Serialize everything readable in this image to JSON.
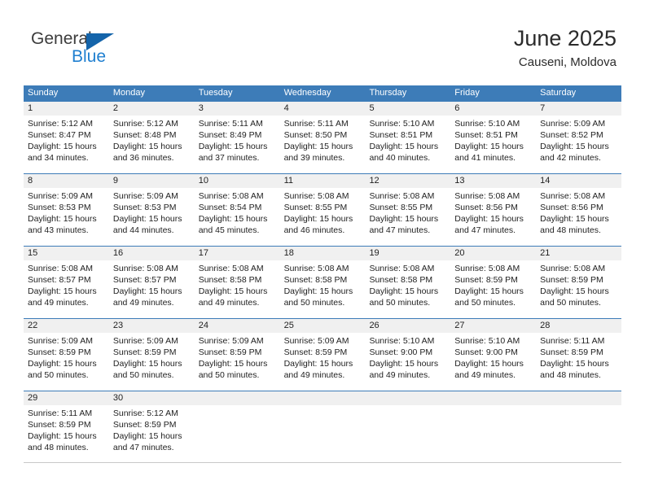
{
  "logo": {
    "word_one": "General",
    "word_two": "Blue",
    "mark": "triangle-flag",
    "color_dark": "#3c3c3c",
    "color_blue": "#1f7fd0"
  },
  "header": {
    "title": "June 2025",
    "subtitle": "Causeni, Moldova"
  },
  "theme": {
    "header_blue": "#3d7cb8",
    "day_band_gray": "#f0f0f0",
    "text": "#1f1f1f"
  },
  "weekdays": [
    "Sunday",
    "Monday",
    "Tuesday",
    "Wednesday",
    "Thursday",
    "Friday",
    "Saturday"
  ],
  "weeks": [
    [
      {
        "day": "1",
        "sunrise": "Sunrise: 5:12 AM",
        "sunset": "Sunset: 8:47 PM",
        "daylight_1": "Daylight: 15 hours",
        "daylight_2": "and 34 minutes."
      },
      {
        "day": "2",
        "sunrise": "Sunrise: 5:12 AM",
        "sunset": "Sunset: 8:48 PM",
        "daylight_1": "Daylight: 15 hours",
        "daylight_2": "and 36 minutes."
      },
      {
        "day": "3",
        "sunrise": "Sunrise: 5:11 AM",
        "sunset": "Sunset: 8:49 PM",
        "daylight_1": "Daylight: 15 hours",
        "daylight_2": "and 37 minutes."
      },
      {
        "day": "4",
        "sunrise": "Sunrise: 5:11 AM",
        "sunset": "Sunset: 8:50 PM",
        "daylight_1": "Daylight: 15 hours",
        "daylight_2": "and 39 minutes."
      },
      {
        "day": "5",
        "sunrise": "Sunrise: 5:10 AM",
        "sunset": "Sunset: 8:51 PM",
        "daylight_1": "Daylight: 15 hours",
        "daylight_2": "and 40 minutes."
      },
      {
        "day": "6",
        "sunrise": "Sunrise: 5:10 AM",
        "sunset": "Sunset: 8:51 PM",
        "daylight_1": "Daylight: 15 hours",
        "daylight_2": "and 41 minutes."
      },
      {
        "day": "7",
        "sunrise": "Sunrise: 5:09 AM",
        "sunset": "Sunset: 8:52 PM",
        "daylight_1": "Daylight: 15 hours",
        "daylight_2": "and 42 minutes."
      }
    ],
    [
      {
        "day": "8",
        "sunrise": "Sunrise: 5:09 AM",
        "sunset": "Sunset: 8:53 PM",
        "daylight_1": "Daylight: 15 hours",
        "daylight_2": "and 43 minutes."
      },
      {
        "day": "9",
        "sunrise": "Sunrise: 5:09 AM",
        "sunset": "Sunset: 8:53 PM",
        "daylight_1": "Daylight: 15 hours",
        "daylight_2": "and 44 minutes."
      },
      {
        "day": "10",
        "sunrise": "Sunrise: 5:08 AM",
        "sunset": "Sunset: 8:54 PM",
        "daylight_1": "Daylight: 15 hours",
        "daylight_2": "and 45 minutes."
      },
      {
        "day": "11",
        "sunrise": "Sunrise: 5:08 AM",
        "sunset": "Sunset: 8:55 PM",
        "daylight_1": "Daylight: 15 hours",
        "daylight_2": "and 46 minutes."
      },
      {
        "day": "12",
        "sunrise": "Sunrise: 5:08 AM",
        "sunset": "Sunset: 8:55 PM",
        "daylight_1": "Daylight: 15 hours",
        "daylight_2": "and 47 minutes."
      },
      {
        "day": "13",
        "sunrise": "Sunrise: 5:08 AM",
        "sunset": "Sunset: 8:56 PM",
        "daylight_1": "Daylight: 15 hours",
        "daylight_2": "and 47 minutes."
      },
      {
        "day": "14",
        "sunrise": "Sunrise: 5:08 AM",
        "sunset": "Sunset: 8:56 PM",
        "daylight_1": "Daylight: 15 hours",
        "daylight_2": "and 48 minutes."
      }
    ],
    [
      {
        "day": "15",
        "sunrise": "Sunrise: 5:08 AM",
        "sunset": "Sunset: 8:57 PM",
        "daylight_1": "Daylight: 15 hours",
        "daylight_2": "and 49 minutes."
      },
      {
        "day": "16",
        "sunrise": "Sunrise: 5:08 AM",
        "sunset": "Sunset: 8:57 PM",
        "daylight_1": "Daylight: 15 hours",
        "daylight_2": "and 49 minutes."
      },
      {
        "day": "17",
        "sunrise": "Sunrise: 5:08 AM",
        "sunset": "Sunset: 8:58 PM",
        "daylight_1": "Daylight: 15 hours",
        "daylight_2": "and 49 minutes."
      },
      {
        "day": "18",
        "sunrise": "Sunrise: 5:08 AM",
        "sunset": "Sunset: 8:58 PM",
        "daylight_1": "Daylight: 15 hours",
        "daylight_2": "and 50 minutes."
      },
      {
        "day": "19",
        "sunrise": "Sunrise: 5:08 AM",
        "sunset": "Sunset: 8:58 PM",
        "daylight_1": "Daylight: 15 hours",
        "daylight_2": "and 50 minutes."
      },
      {
        "day": "20",
        "sunrise": "Sunrise: 5:08 AM",
        "sunset": "Sunset: 8:59 PM",
        "daylight_1": "Daylight: 15 hours",
        "daylight_2": "and 50 minutes."
      },
      {
        "day": "21",
        "sunrise": "Sunrise: 5:08 AM",
        "sunset": "Sunset: 8:59 PM",
        "daylight_1": "Daylight: 15 hours",
        "daylight_2": "and 50 minutes."
      }
    ],
    [
      {
        "day": "22",
        "sunrise": "Sunrise: 5:09 AM",
        "sunset": "Sunset: 8:59 PM",
        "daylight_1": "Daylight: 15 hours",
        "daylight_2": "and 50 minutes."
      },
      {
        "day": "23",
        "sunrise": "Sunrise: 5:09 AM",
        "sunset": "Sunset: 8:59 PM",
        "daylight_1": "Daylight: 15 hours",
        "daylight_2": "and 50 minutes."
      },
      {
        "day": "24",
        "sunrise": "Sunrise: 5:09 AM",
        "sunset": "Sunset: 8:59 PM",
        "daylight_1": "Daylight: 15 hours",
        "daylight_2": "and 50 minutes."
      },
      {
        "day": "25",
        "sunrise": "Sunrise: 5:09 AM",
        "sunset": "Sunset: 8:59 PM",
        "daylight_1": "Daylight: 15 hours",
        "daylight_2": "and 49 minutes."
      },
      {
        "day": "26",
        "sunrise": "Sunrise: 5:10 AM",
        "sunset": "Sunset: 9:00 PM",
        "daylight_1": "Daylight: 15 hours",
        "daylight_2": "and 49 minutes."
      },
      {
        "day": "27",
        "sunrise": "Sunrise: 5:10 AM",
        "sunset": "Sunset: 9:00 PM",
        "daylight_1": "Daylight: 15 hours",
        "daylight_2": "and 49 minutes."
      },
      {
        "day": "28",
        "sunrise": "Sunrise: 5:11 AM",
        "sunset": "Sunset: 8:59 PM",
        "daylight_1": "Daylight: 15 hours",
        "daylight_2": "and 48 minutes."
      }
    ],
    [
      {
        "day": "29",
        "sunrise": "Sunrise: 5:11 AM",
        "sunset": "Sunset: 8:59 PM",
        "daylight_1": "Daylight: 15 hours",
        "daylight_2": "and 48 minutes."
      },
      {
        "day": "30",
        "sunrise": "Sunrise: 5:12 AM",
        "sunset": "Sunset: 8:59 PM",
        "daylight_1": "Daylight: 15 hours",
        "daylight_2": "and 47 minutes."
      },
      null,
      null,
      null,
      null,
      null
    ]
  ]
}
